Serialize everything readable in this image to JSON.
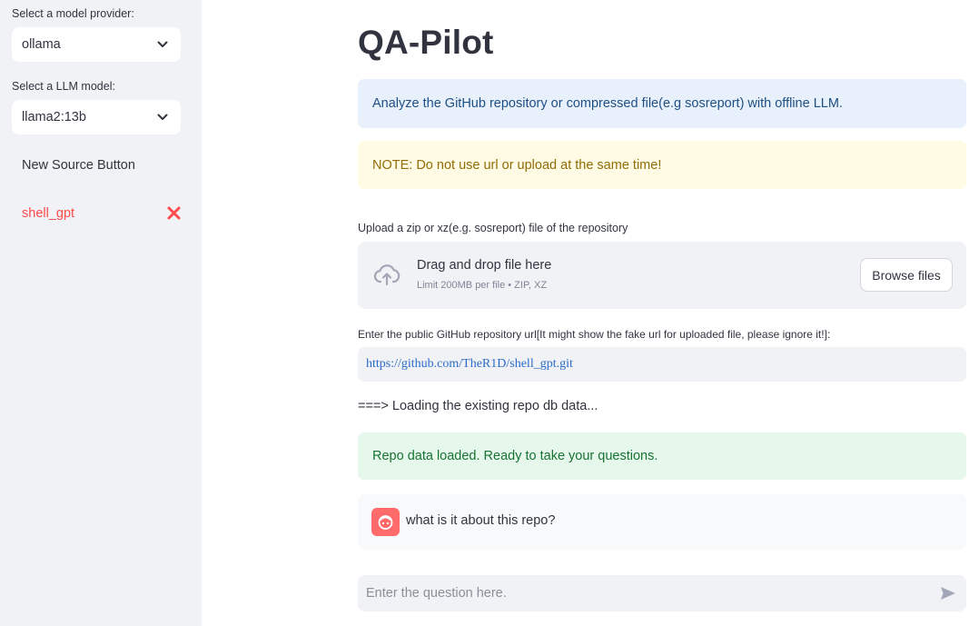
{
  "sidebar": {
    "provider_label": "Select a model provider:",
    "provider_value": "ollama",
    "model_label": "Select a LLM model:",
    "model_value": "llama2:13b",
    "new_source_label": "New Source Button",
    "sources": [
      {
        "label": "shell_gpt"
      }
    ]
  },
  "main": {
    "title": "QA-Pilot",
    "info_text": "Analyze the GitHub repository or compressed file(e.g sosreport) with offline LLM.",
    "warning_text": "NOTE: Do not use url or upload at the same time!",
    "upload": {
      "label": "Upload a zip or xz(e.g. sosreport) file of the repository",
      "drop_title": "Drag and drop file here",
      "drop_subtitle": "Limit 200MB per file • ZIP, XZ",
      "browse_label": "Browse files"
    },
    "url": {
      "label": "Enter the public GitHub repository url[It might show the fake url for uploaded file, please ignore it!]:",
      "value": "https://github.com/TheR1D/shell_gpt.git"
    },
    "loading_text": "===> Loading the existing repo db data...",
    "success_text": "Repo data loaded. Ready to take your questions.",
    "chat": [
      {
        "role": "user",
        "text": "what is it about this repo?"
      }
    ],
    "question_placeholder": "Enter the question here."
  },
  "colors": {
    "accent": "#ff4b4b",
    "sidebar_bg": "#f0f2f6",
    "info_bg": "#e8f0fb",
    "warning_bg": "#fffbe4",
    "success_bg": "#e6f8ec",
    "avatar_bg": "#ff6b6b"
  },
  "icons": {
    "select_chevron": "chevron-down-icon",
    "remove_source": "close-icon",
    "upload": "cloud-upload-icon",
    "user_avatar": "user-face-icon",
    "send": "send-icon"
  }
}
